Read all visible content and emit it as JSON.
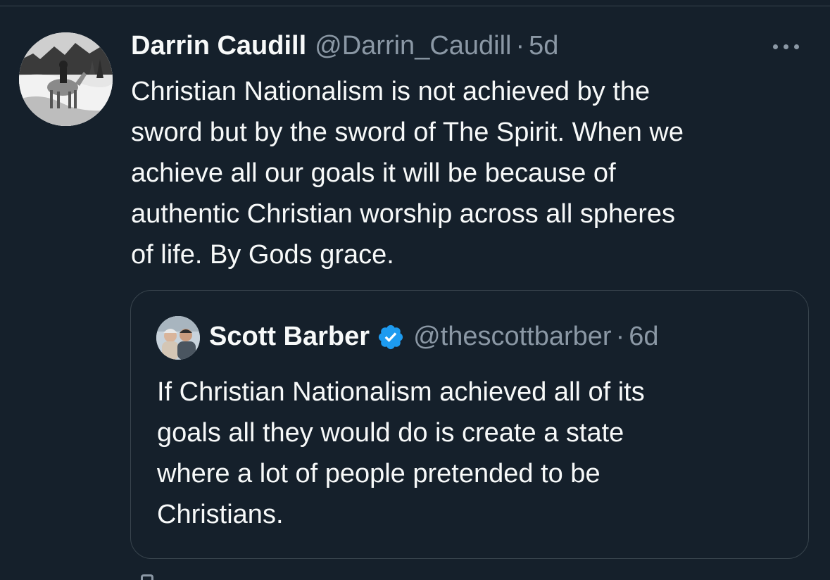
{
  "tweet": {
    "author_name": "Darrin Caudill",
    "author_handle": "@Darrin_Caudill",
    "separator": "·",
    "time": "5d",
    "text": "Christian Nationalism is not achieved by the\nsword but by the sword of The Spirit. When we\nachieve all our goals it will be because of\nauthentic Christian worship across all spheres\nof life. By Gods grace.",
    "more_icon": "more-horizontal-icon"
  },
  "quoted_tweet": {
    "author_name": "Scott Barber",
    "verified_icon": "verified-badge-icon",
    "verified_color": "#1d9bf0",
    "author_handle": "@thescottbarber",
    "separator": "·",
    "time": "6d",
    "text": "If Christian Nationalism achieved all of its\ngoals all they would do is create a state\nwhere a lot of people pretended to be\nChristians."
  },
  "colors": {
    "background": "#15202b",
    "text_primary": "#f7f9f9",
    "text_secondary": "#8b98a5",
    "border": "#38444d"
  }
}
